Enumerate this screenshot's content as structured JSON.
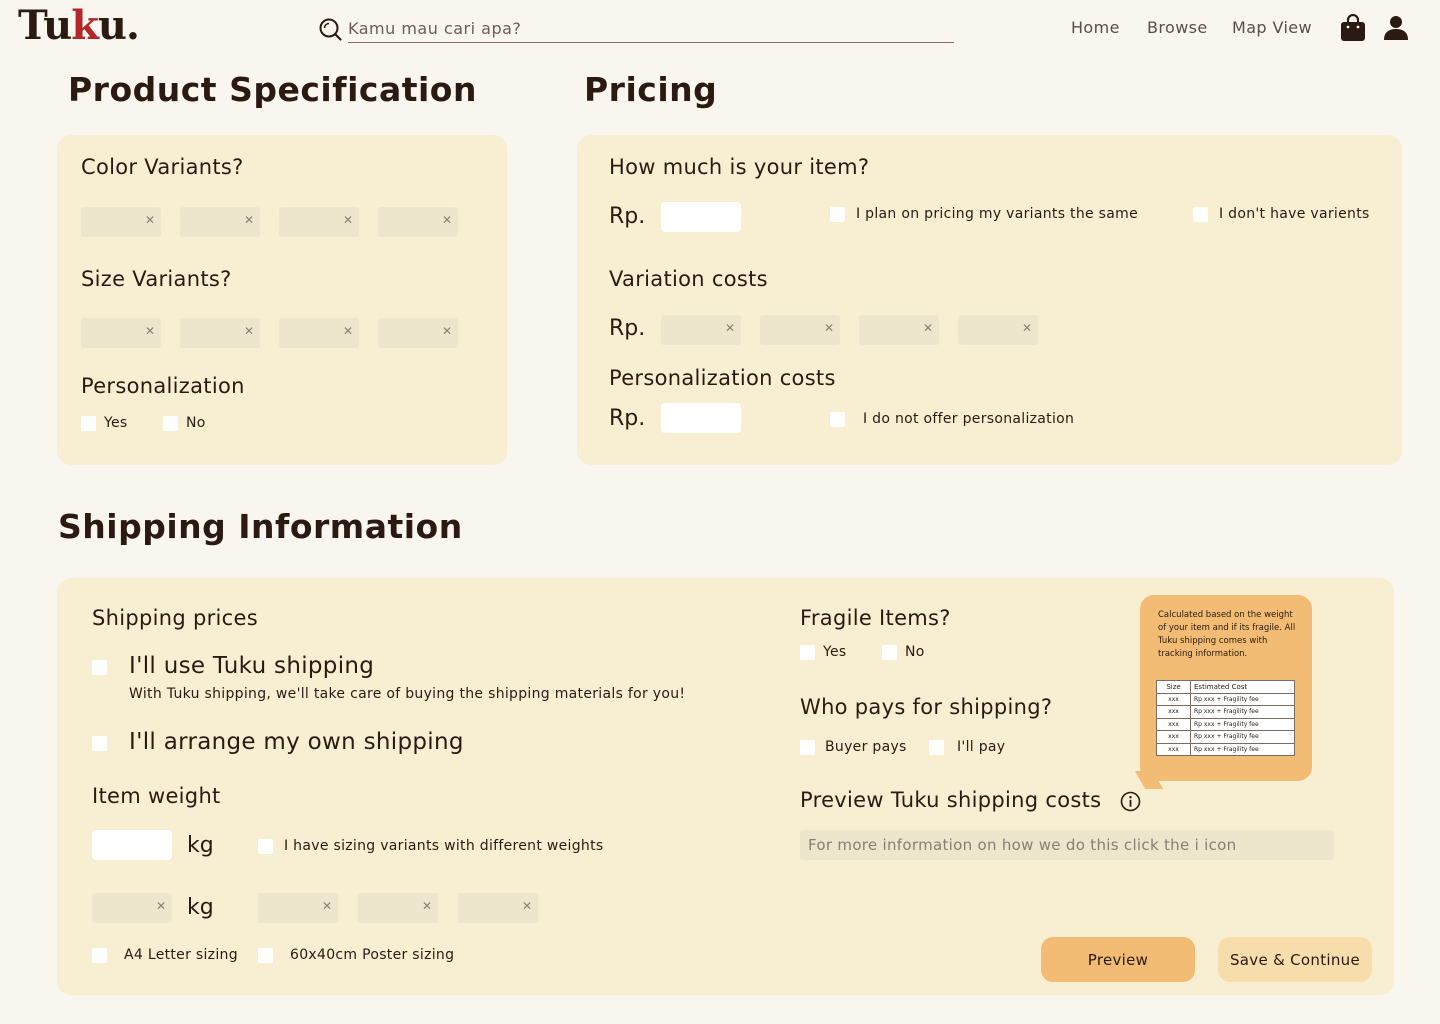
{
  "header": {
    "logo_prefix": "Tu",
    "logo_k": "k",
    "logo_suffix": "u.",
    "search_placeholder": "Kamu mau cari apa?",
    "nav": [
      "Home",
      "Browse",
      "Map View"
    ]
  },
  "product_spec": {
    "title": "Product Specification",
    "color_variants": "Color Variants?",
    "size_variants": "Size Variants?",
    "personalization": "Personalization",
    "yes": "Yes",
    "no": "No"
  },
  "pricing": {
    "title": "Pricing",
    "how_much": "How much is your item?",
    "rp": "Rp.",
    "same_price": "I plan on pricing my variants the same",
    "no_variants": "I don't have varients",
    "variation_costs": "Variation costs",
    "personalization_costs": "Personalization costs",
    "no_personalization": "I do not offer personalization"
  },
  "shipping": {
    "title": "Shipping Information",
    "shipping_prices": "Shipping prices",
    "tuku_shipping": "I'll use Tuku shipping",
    "tuku_shipping_note": "With Tuku shipping, we'll take care of buying the shipping materials for you!",
    "own_shipping": "I'll arrange my own shipping",
    "item_weight": "Item weight",
    "kg": "kg",
    "sizing_variants": "I have sizing variants with different weights",
    "a4": "A4 Letter sizing",
    "poster": "60x40cm Poster sizing",
    "fragile": "Fragile Items?",
    "yes": "Yes",
    "no": "No",
    "who_pays": "Who pays for shipping?",
    "buyer_pays": "Buyer pays",
    "ill_pay": "I'll pay",
    "preview_costs": "Preview Tuku shipping costs",
    "info_bar": "For more information on how we do this click the i icon",
    "preview_btn": "Preview",
    "save_btn": "Save & Continue"
  },
  "tooltip": {
    "text": "Calculated based on the weight of your item and if its fragile. All Tuku shipping comes with tracking information.",
    "col_size": "Size",
    "col_cost": "Estimated Cost",
    "rows": [
      {
        "size": "xxx",
        "cost": "Rp xxx + Fragility fee"
      },
      {
        "size": "xxx",
        "cost": "Rp xxx + Fragility fee"
      },
      {
        "size": "xxx",
        "cost": "Rp xxx + Fragility fee"
      },
      {
        "size": "xxx",
        "cost": "Rp xxx + Fragility fee"
      },
      {
        "size": "xxx",
        "cost": "Rp xxx + Fragility fee"
      }
    ]
  },
  "colors": {
    "background": "#f9f6ef",
    "card": "#f8eed2",
    "accent": "#f2bc74",
    "button_light": "#f7dcac",
    "logo_accent": "#b3262a"
  }
}
